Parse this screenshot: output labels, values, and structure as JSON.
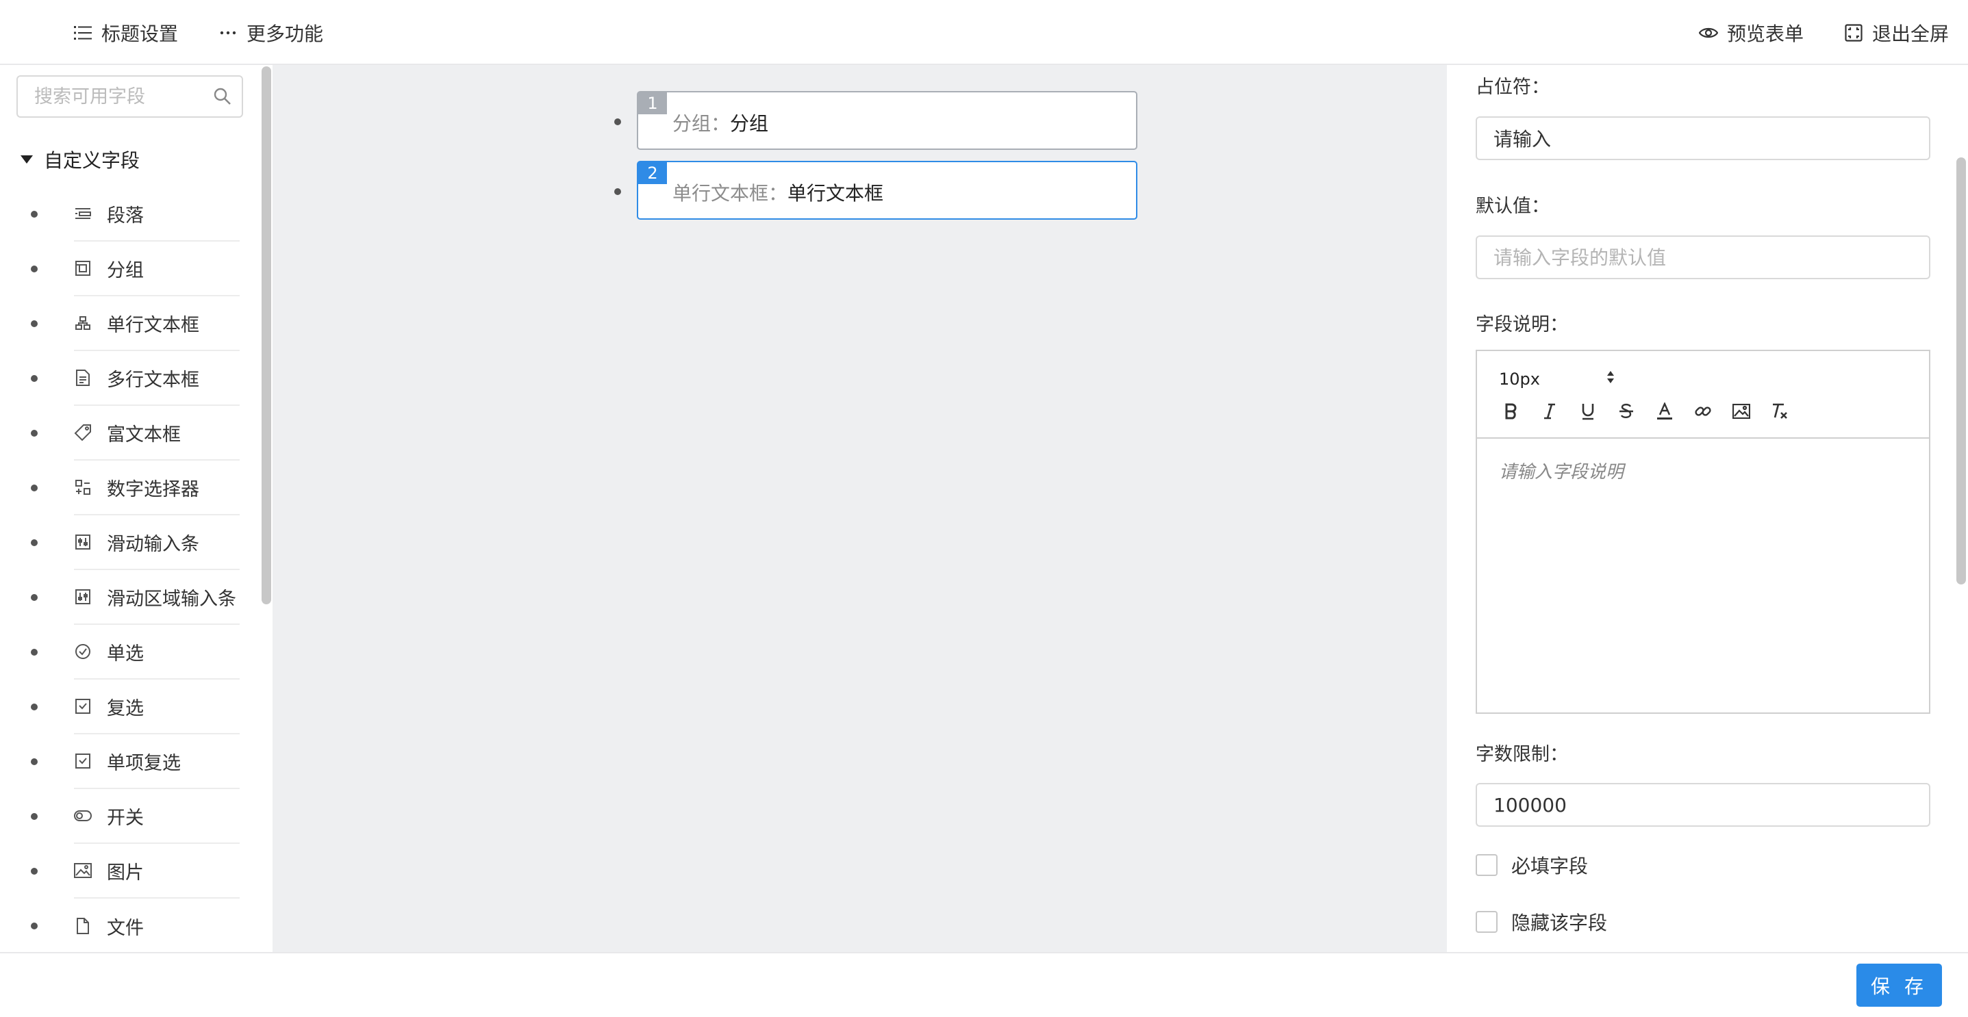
{
  "topbar": {
    "title_settings": "标题设置",
    "more_features": "更多功能",
    "preview_form": "预览表单",
    "exit_fullscreen": "退出全屏"
  },
  "sidebar": {
    "search_placeholder": "搜索可用字段",
    "group_title": "自定义字段",
    "items": [
      {
        "label": "段落",
        "icon": "paragraph-icon"
      },
      {
        "label": "分组",
        "icon": "group-icon"
      },
      {
        "label": "单行文本框",
        "icon": "text-input-icon"
      },
      {
        "label": "多行文本框",
        "icon": "textarea-icon"
      },
      {
        "label": "富文本框",
        "icon": "rich-text-icon"
      },
      {
        "label": "数字选择器",
        "icon": "number-picker-icon"
      },
      {
        "label": "滑动输入条",
        "icon": "slider-icon"
      },
      {
        "label": "滑动区域输入条",
        "icon": "range-slider-icon"
      },
      {
        "label": "单选",
        "icon": "radio-icon"
      },
      {
        "label": "复选",
        "icon": "checkbox-icon"
      },
      {
        "label": "单项复选",
        "icon": "single-checkbox-icon"
      },
      {
        "label": "开关",
        "icon": "switch-icon"
      },
      {
        "label": "图片",
        "icon": "image-icon"
      },
      {
        "label": "文件",
        "icon": "file-icon"
      }
    ]
  },
  "canvas": {
    "items": [
      {
        "num": "1",
        "label": "分组：",
        "value": "分组"
      },
      {
        "num": "2",
        "label": "单行文本框：",
        "value": "单行文本框"
      }
    ]
  },
  "panel": {
    "placeholder_label": "占位符：",
    "placeholder_value": "请输入",
    "default_label": "默认值：",
    "default_placeholder": "请输入字段的默认值",
    "description_label": "字段说明：",
    "font_size": "10px",
    "editor_placeholder": "请输入字段说明",
    "limit_label": "字数限制：",
    "limit_value": "100000",
    "required_label": "必填字段",
    "hidden_label": "隐藏该字段"
  },
  "footer": {
    "save_label": "保 存"
  },
  "colors": {
    "accent": "#2a8be8",
    "canvas_bg": "#eeeff1",
    "card_border": "#a9aeb5"
  }
}
